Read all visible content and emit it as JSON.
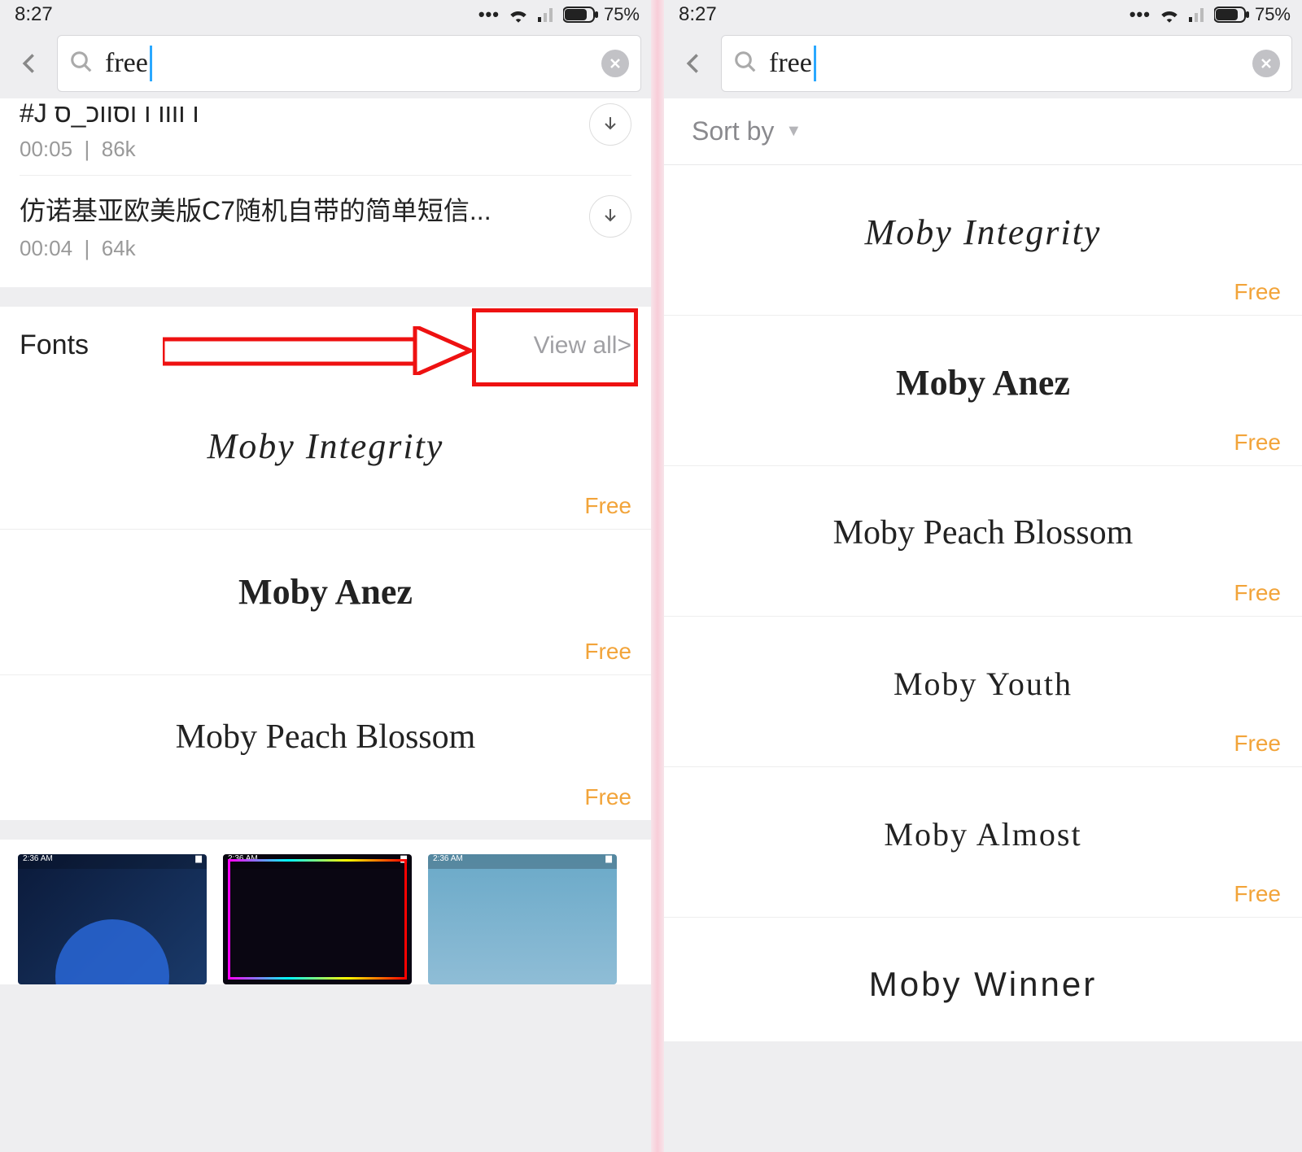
{
  "status": {
    "time": "8:27",
    "battery_pct": "75%"
  },
  "search": {
    "value": "free"
  },
  "left": {
    "ringtones": [
      {
        "title": "#J ו וווו ו וסווכ_ס",
        "time": "00:05",
        "size": "86k"
      },
      {
        "title": "仿诺基亚欧美版C7随机自带的简单短信...",
        "time": "00:04",
        "size": "64k"
      }
    ],
    "fonts_header": "Fonts",
    "view_all": "View all>",
    "fonts": [
      {
        "name": "Moby Integrity",
        "price": "Free",
        "styleClass": "f-script"
      },
      {
        "name": "Moby Anez",
        "price": "Free",
        "styleClass": "f-marker"
      },
      {
        "name": "Moby Peach Blossom",
        "price": "Free",
        "styleClass": "f-hand"
      }
    ]
  },
  "right": {
    "sort_label": "Sort by",
    "fonts": [
      {
        "name": "Moby Integrity",
        "price": "Free",
        "styleClass": "f-script"
      },
      {
        "name": "Moby Anez",
        "price": "Free",
        "styleClass": "f-marker"
      },
      {
        "name": "Moby Peach Blossom",
        "price": "Free",
        "styleClass": "f-hand"
      },
      {
        "name": "Moby Youth",
        "price": "Free",
        "styleClass": "f-thin"
      },
      {
        "name": "Moby Almost",
        "price": "Free",
        "styleClass": "f-deco"
      },
      {
        "name": "Moby Winner",
        "price": "",
        "styleClass": "f-stencil"
      }
    ]
  }
}
